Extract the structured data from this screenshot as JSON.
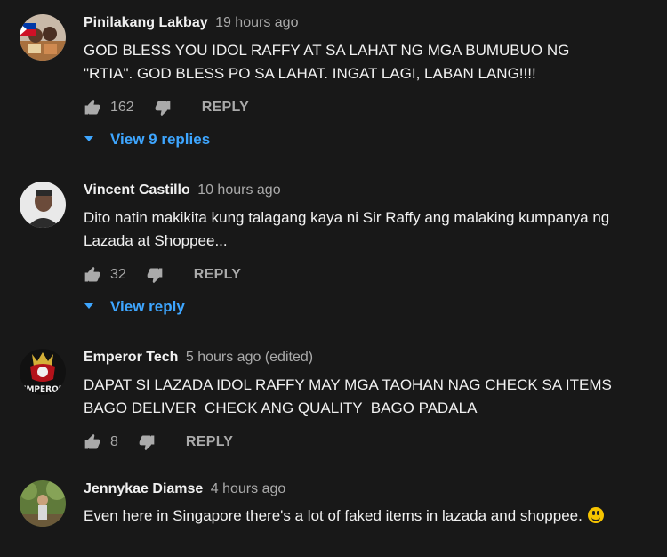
{
  "comments": [
    {
      "author": "Pinilakang Lakbay",
      "time": "19 hours ago",
      "text": "GOD BLESS YOU IDOL RAFFY AT SA LAHAT NG MGA BUMUBUO NG \"RTIA\". GOD BLESS PO SA LAHAT. INGAT LAGI, LABAN LANG!!!!",
      "likes": "162",
      "reply_label": "REPLY",
      "view_replies": "View 9 replies"
    },
    {
      "author": "Vincent Castillo",
      "time": "10 hours ago",
      "text": "Dito natin makikita kung talagang kaya ni Sir Raffy ang malaking kumpanya ng Lazada at Shoppee...",
      "likes": "32",
      "reply_label": "REPLY",
      "view_replies": "View reply"
    },
    {
      "author": "Emperor Tech",
      "time": "5 hours ago (edited)",
      "text": "DAPAT SI LAZADA IDOL RAFFY MAY MGA TAOHAN NAG CHECK SA ITEMS BAGO DELIVER  CHECK ANG QUALITY  BAGO PADALA",
      "likes": "8",
      "reply_label": "REPLY",
      "avatar_text": "EMPEROR"
    },
    {
      "author": "Jennykae Diamse",
      "time": "4 hours ago",
      "text": "Even here in Singapore there's a lot of faked items in lazada and shoppee."
    }
  ],
  "colors": {
    "background": "#181818",
    "text": "#f1f1f1",
    "secondary": "#aaaaaa",
    "link": "#3ea6ff"
  }
}
